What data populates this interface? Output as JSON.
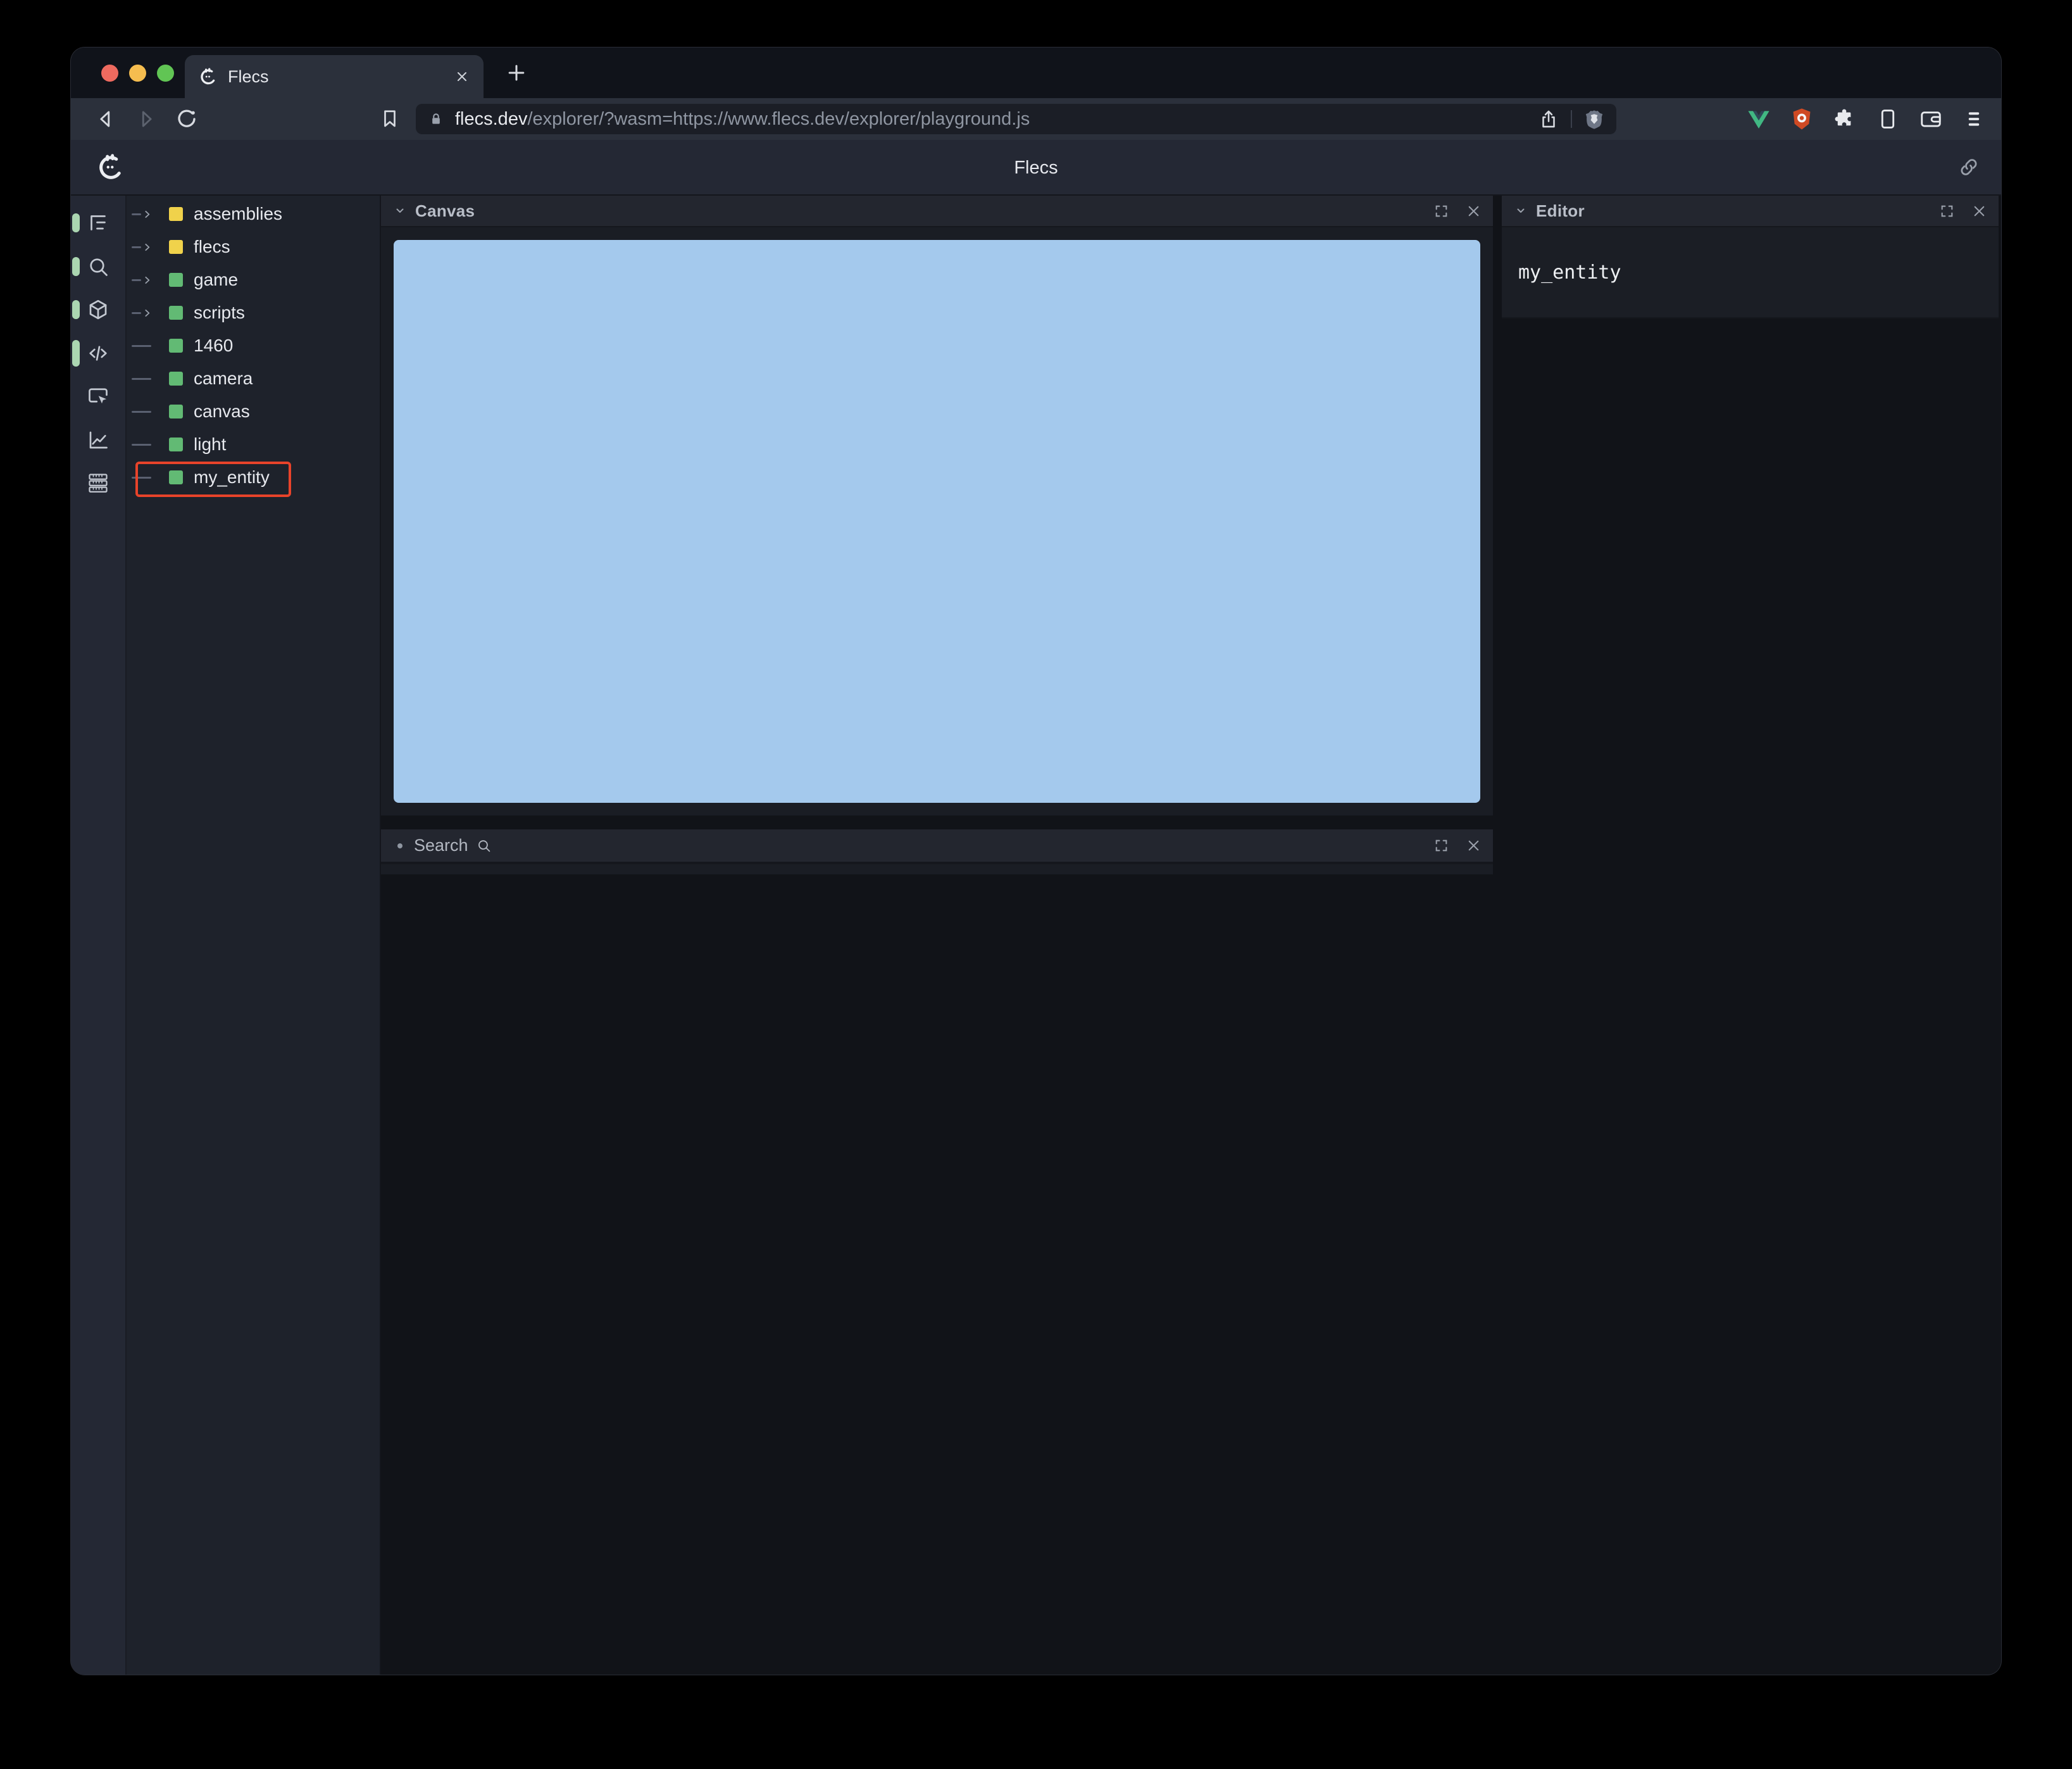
{
  "browser": {
    "tab_title": "Flecs",
    "url_domain": "flecs.dev",
    "url_path": "/explorer/?wasm=https://www.flecs.dev/explorer/playground.js",
    "extension_icons": [
      "vue-devtools-icon",
      "shield-extension-icon",
      "extensions-puzzle-icon",
      "sidebar-toggle-icon",
      "wallet-icon",
      "menu-icon"
    ],
    "traffic_lights": {
      "close": "#ee6a5f",
      "minimize": "#f5bd4f",
      "zoom": "#61c554"
    }
  },
  "app": {
    "title": "Flecs",
    "colors": {
      "yellow": "#f0d24b",
      "green": "#62ba74",
      "canvas_blue": "#a4c9ed",
      "highlight_red": "#e8432a",
      "pill_green": "#abd6b1"
    },
    "sidebar": {
      "items": [
        {
          "icon": "entities-tree-icon",
          "active": true
        },
        {
          "icon": "query-search-icon",
          "active": true
        },
        {
          "icon": "components-cube-icon",
          "active": true
        },
        {
          "icon": "code-icon",
          "active": true,
          "tall": true
        },
        {
          "icon": "inspect-icon",
          "active": false
        },
        {
          "icon": "statistics-icon",
          "active": false
        },
        {
          "icon": "tables-icon",
          "active": false
        }
      ]
    },
    "tree": {
      "items": [
        {
          "label": "assemblies",
          "color": "yellow",
          "expandable": true
        },
        {
          "label": "flecs",
          "color": "yellow",
          "expandable": true
        },
        {
          "label": "game",
          "color": "green",
          "expandable": true
        },
        {
          "label": "scripts",
          "color": "green",
          "expandable": true
        },
        {
          "label": "1460",
          "color": "green",
          "expandable": false
        },
        {
          "label": "camera",
          "color": "green",
          "expandable": false
        },
        {
          "label": "canvas",
          "color": "green",
          "expandable": false
        },
        {
          "label": "light",
          "color": "green",
          "expandable": false
        },
        {
          "label": "my_entity",
          "color": "green",
          "expandable": false,
          "highlighted": true
        }
      ]
    },
    "panels": {
      "canvas": {
        "title": "Canvas"
      },
      "search": {
        "label": "Search"
      },
      "editor": {
        "title": "Editor",
        "content": "my_entity"
      }
    }
  }
}
